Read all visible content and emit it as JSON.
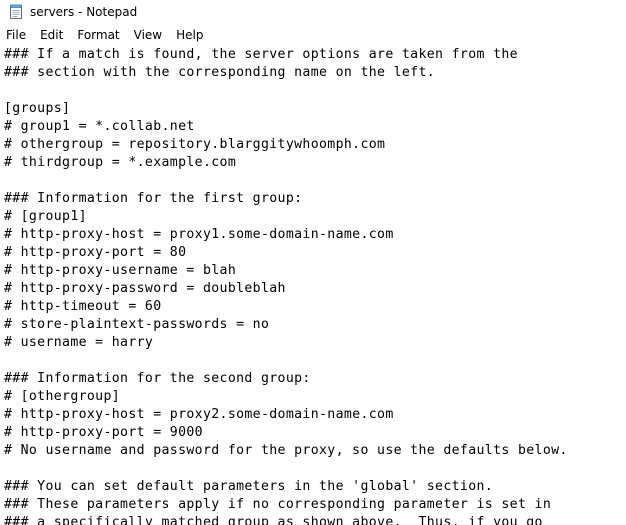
{
  "window": {
    "title": "servers - Notepad",
    "icon": "notepad-icon"
  },
  "menu": {
    "items": [
      {
        "label": "File"
      },
      {
        "label": "Edit"
      },
      {
        "label": "Format"
      },
      {
        "label": "View"
      },
      {
        "label": "Help"
      }
    ]
  },
  "editor": {
    "lines": [
      "### If a match is found, the server options are taken from the",
      "### section with the corresponding name on the left.",
      "",
      "[groups]",
      "# group1 = *.collab.net",
      "# othergroup = repository.blarggitywhoomph.com",
      "# thirdgroup = *.example.com",
      "",
      "### Information for the first group:",
      "# [group1]",
      "# http-proxy-host = proxy1.some-domain-name.com",
      "# http-proxy-port = 80",
      "# http-proxy-username = blah",
      "# http-proxy-password = doubleblah",
      "# http-timeout = 60",
      "# store-plaintext-passwords = no",
      "# username = harry",
      "",
      "### Information for the second group:",
      "# [othergroup]",
      "# http-proxy-host = proxy2.some-domain-name.com",
      "# http-proxy-port = 9000",
      "# No username and password for the proxy, so use the defaults below.",
      "",
      "### You can set default parameters in the 'global' section.",
      "### These parameters apply if no corresponding parameter is set in",
      "### a specifically matched group as shown above.  Thus, if you go"
    ]
  }
}
